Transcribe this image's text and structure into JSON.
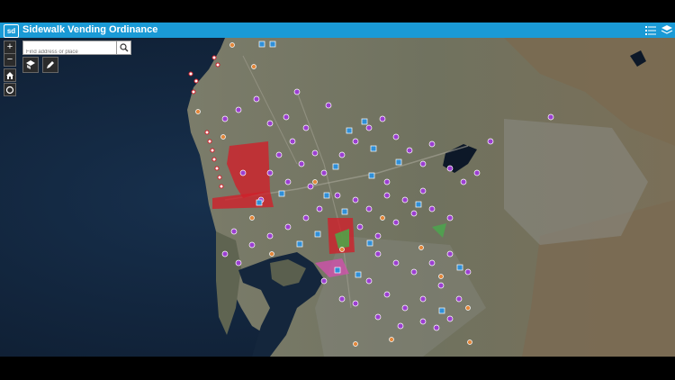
{
  "app": {
    "title": "Sidewalk Vending Ordinance",
    "logo_text": "sd"
  },
  "header_icons": [
    "list-icon",
    "layers-icon"
  ],
  "search": {
    "placeholder": "Find address or place"
  },
  "map_controls": {
    "zoom_in": "+",
    "zoom_out": "−"
  },
  "colors": {
    "header": "#1a9ad6",
    "ocean": "#12233a",
    "land": "#6f7361",
    "poi_purple": "#9c3fd1",
    "poi_blue": "#2f8fd8",
    "poi_orange": "#e4873a",
    "restricted_zone": "#d0202a"
  }
}
